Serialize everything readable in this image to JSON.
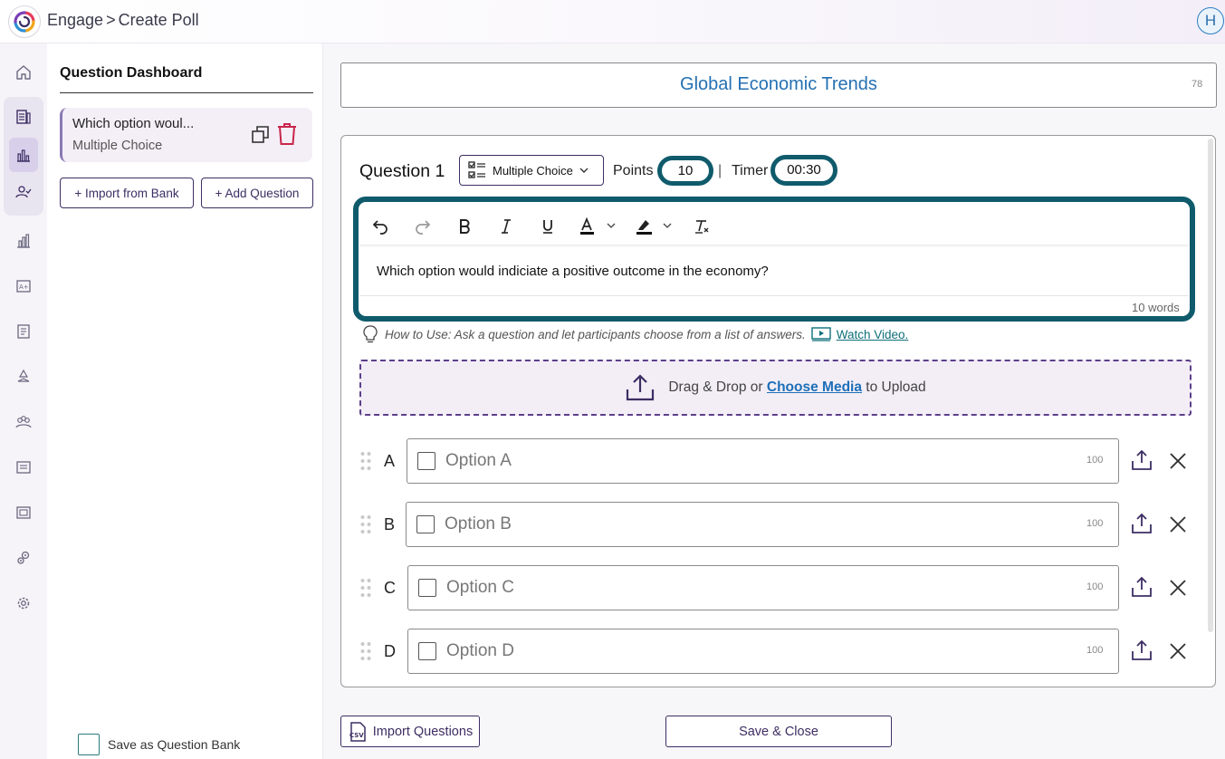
{
  "header": {
    "app_name": "Engage",
    "separator": ">",
    "page": "Create Poll",
    "avatar_initial": "H"
  },
  "rail": {
    "icons": [
      "home-icon",
      "quiz-icon",
      "poll-icon",
      "survey-icon",
      "report-icon",
      "grade-icon",
      "document-icon",
      "recycle-icon",
      "team-icon",
      "list-icon",
      "gallery-icon",
      "integrations-icon",
      "settings-icon"
    ],
    "active": "poll-icon"
  },
  "dashboard": {
    "title": "Question Dashboard",
    "question_card": {
      "title": "Which option woul...",
      "type": "Multiple Choice"
    },
    "import_from_bank": "+ Import from Bank",
    "add_question": "+ Add Question",
    "save_as_bank": "Save as Question Bank"
  },
  "poll": {
    "title": "Global Economic Trends",
    "title_remaining": "78"
  },
  "question": {
    "label": "Question 1",
    "type": "Multiple Choice",
    "points_label": "Points",
    "points": "10",
    "separator": "|",
    "timer_label": "Timer",
    "timer": "00:30",
    "text": "Which option would indiciate a positive outcome in the economy?",
    "word_count": "10 words",
    "how_to": "How to Use: Ask a question and let participants choose from a list of answers.",
    "watch_video": "Watch Video."
  },
  "upload": {
    "prefix": "Drag & Drop or",
    "link": "Choose Media",
    "suffix": "to Upload"
  },
  "options": [
    {
      "letter": "A",
      "placeholder": "Option A",
      "remaining": "100"
    },
    {
      "letter": "B",
      "placeholder": "Option B",
      "remaining": "100"
    },
    {
      "letter": "C",
      "placeholder": "Option C",
      "remaining": "100"
    },
    {
      "letter": "D",
      "placeholder": "Option D",
      "remaining": "100"
    }
  ],
  "footer": {
    "import_questions": "Import Questions",
    "csv_icon_text": "CSV",
    "save_close": "Save & Close"
  },
  "colors": {
    "accent_purple": "#3d2e63",
    "teal_highlight": "#0f5b6c",
    "title_blue": "#2470b3",
    "delete_red": "#c8254a"
  }
}
